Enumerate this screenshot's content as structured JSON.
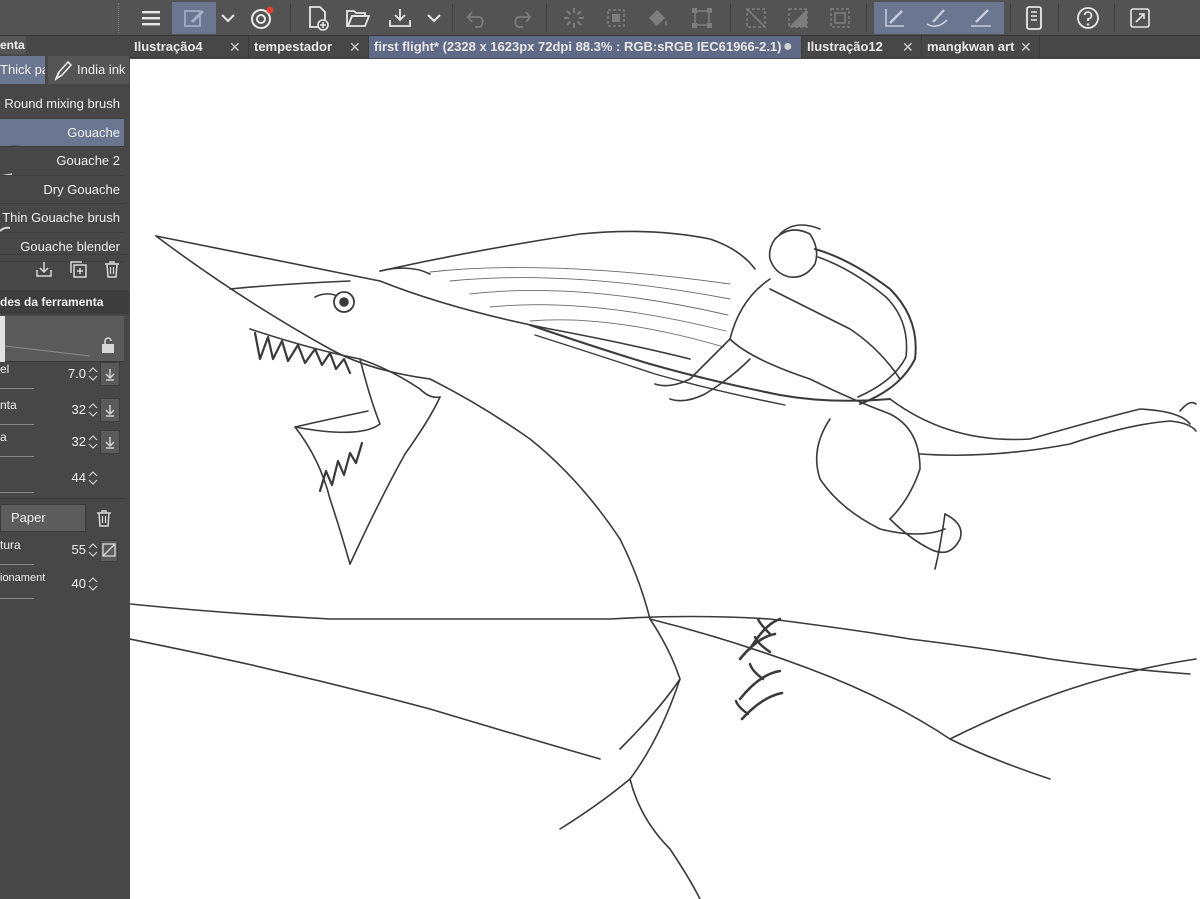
{
  "toolbar": {
    "icons": [
      "menu-icon",
      "tool-settings-icon",
      "dropdown-arrow-icon",
      "companion-app-icon",
      "new-file-icon",
      "open-folder-icon",
      "export-icon",
      "dropdown-arrow-icon",
      "undo-icon",
      "redo-icon",
      "loading-icon",
      "select-all-icon",
      "fill-icon",
      "transform-icon",
      "deselect-icon",
      "invert-selection-icon",
      "border-selection-icon",
      "pen-pressure-icon",
      "brush-pressure-icon",
      "line-pressure-icon",
      "device-icon",
      "help-icon",
      "fullscreen-icon"
    ]
  },
  "left_panel": {
    "panel_tab": "enta",
    "subtools": [
      {
        "label": "Thick pa",
        "selected": true
      },
      {
        "label": "India ink",
        "selected": false
      }
    ],
    "brushes": [
      {
        "label": "Round mixing brush",
        "selected": false
      },
      {
        "label": "Gouache",
        "selected": true
      },
      {
        "label": "Gouache 2",
        "selected": false
      },
      {
        "label": "Dry Gouache",
        "selected": false
      },
      {
        "label": "Thin Gouache brush",
        "selected": false
      },
      {
        "label": "Gouache blender",
        "selected": false
      }
    ],
    "section_title": "des da ferramenta",
    "properties": [
      {
        "label": "el",
        "value": "7.0"
      },
      {
        "label": "nta",
        "value": "32"
      },
      {
        "label": "a",
        "value": "32"
      },
      {
        "label": "",
        "value": "44"
      }
    ],
    "paper_label": "Paper",
    "texture_props": [
      {
        "label": "tura",
        "value": "55"
      },
      {
        "label": "ionament",
        "value": "40"
      }
    ]
  },
  "tabs": [
    {
      "label": "Ilustração4",
      "active": false,
      "modified": false
    },
    {
      "label": "tempestador",
      "active": false,
      "modified": false
    },
    {
      "label": "first flight* (2328 x 1623px 72dpi 88.3% : RGB:sRGB IEC61966-2.1)",
      "active": true,
      "modified": true
    },
    {
      "label": "Ilustração12",
      "active": false,
      "modified": false
    },
    {
      "label": "mangkwan art",
      "active": false,
      "modified": false
    }
  ],
  "colors": {
    "toolbar_bg": "#535353",
    "panel_bg": "#474747",
    "active_tab": "#5f6a86",
    "selected_item": "#6b7690",
    "canvas_bg": "#ffffff",
    "sketch_stroke": "#3a3a3a"
  }
}
